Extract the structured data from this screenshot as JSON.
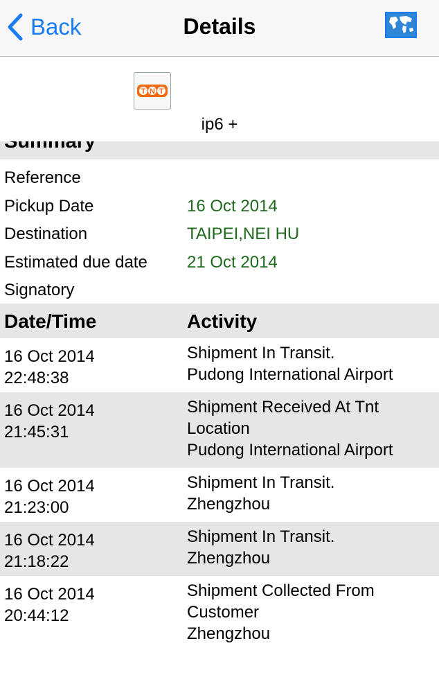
{
  "navbar": {
    "back_label": "Back",
    "title": "Details",
    "map_icon": "world-map-icon",
    "accent": "#1a7cf5"
  },
  "header": {
    "logo_text": "TNT",
    "logo_color": "#f26a10",
    "product_name": "ip6 +"
  },
  "summary": {
    "title": "Summary",
    "rows": [
      {
        "label": "Reference",
        "value": ""
      },
      {
        "label": "Pickup Date",
        "value": "16 Oct 2014"
      },
      {
        "label": "Destination",
        "value": "TAIPEI,NEI HU"
      },
      {
        "label": "Estimated due date",
        "value": "21 Oct 2014"
      },
      {
        "label": "Signatory",
        "value": ""
      }
    ],
    "value_color": "#1e6b1e"
  },
  "activity_table": {
    "headers": {
      "datetime": "Date/Time",
      "activity": "Activity"
    },
    "rows": [
      {
        "date": "16 Oct 2014",
        "time": "22:48:38",
        "status": [
          "Shipment In Transit."
        ],
        "location": "Pudong International Airport"
      },
      {
        "date": "16 Oct 2014",
        "time": "21:45:31",
        "status": [
          "Shipment Received At Tnt",
          "Location"
        ],
        "location": "Pudong International Airport"
      },
      {
        "date": "16 Oct 2014",
        "time": "21:23:00",
        "status": [
          "Shipment In Transit."
        ],
        "location": "Zhengzhou"
      },
      {
        "date": "16 Oct 2014",
        "time": "21:18:22",
        "status": [
          "Shipment In Transit."
        ],
        "location": "Zhengzhou"
      },
      {
        "date": "16 Oct 2014",
        "time": "20:44:12",
        "status": [
          "Shipment Collected From",
          "Customer"
        ],
        "location": "Zhengzhou"
      }
    ]
  }
}
